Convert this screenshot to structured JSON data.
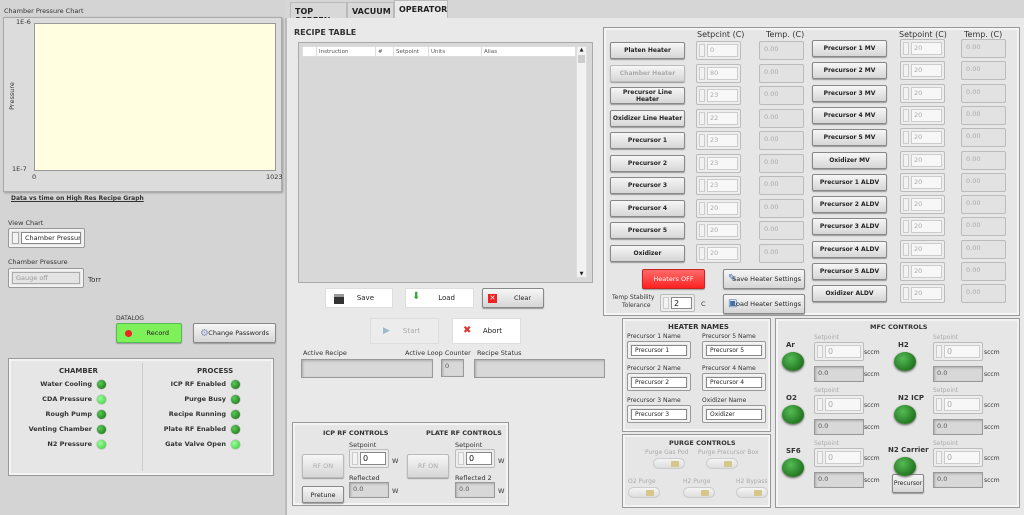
{
  "left": {
    "chart": {
      "title": "Chamber Pressure Chart",
      "ylabel": "Pressure",
      "y_max_label": "1E-6",
      "y_min_label": "1E-7",
      "x_min_label": "0",
      "x_max_label": "1023",
      "background": "#fffee0"
    },
    "chart_link": "Data vs time on High Res Recipe Graph",
    "view_chart": {
      "label": "View Chart",
      "value": "Chamber Pressure"
    },
    "chamber_pressure": {
      "label": "Chamber Pressure",
      "value": "Gauge off",
      "unit": "Torr"
    },
    "datalog": {
      "label": "DATALOG",
      "record": "Record"
    },
    "change_passwords": "Change Passwords",
    "chamber": {
      "title": "CHAMBER",
      "items": [
        {
          "label": "Water Cooling",
          "on": false
        },
        {
          "label": "CDA Pressure",
          "on": true
        },
        {
          "label": "Rough Pump",
          "on": false
        },
        {
          "label": "Venting Chamber",
          "on": false
        },
        {
          "label": "N2 Pressure",
          "on": true
        }
      ]
    },
    "process": {
      "title": "PROCESS",
      "items": [
        {
          "label": "ICP RF Enabled",
          "on": false
        },
        {
          "label": "Purge Busy",
          "on": false
        },
        {
          "label": "Recipe Running",
          "on": false
        },
        {
          "label": "Plate RF Enabled",
          "on": false
        },
        {
          "label": "Gate Valve Open",
          "on": true
        }
      ]
    }
  },
  "tabs": [
    {
      "label": "TOP SCREEN"
    },
    {
      "label": "VACUUM"
    },
    {
      "label": "OPERATOR",
      "active": true
    }
  ],
  "recipe": {
    "title": "RECIPE TABLE",
    "columns": [
      "Instruction",
      "#",
      "Setpoint",
      "Units",
      "Alias"
    ],
    "row_indices": [
      "0",
      "1",
      "2",
      "3",
      "4",
      "5",
      "6",
      "7",
      "8",
      "9",
      "10",
      "11",
      "12",
      "13",
      "14",
      "15",
      "16",
      "17",
      "18",
      "19",
      "20",
      "21"
    ],
    "save": "Save",
    "load": "Load",
    "clear": "Clear",
    "start": "Start",
    "abort": "Abort",
    "active_recipe": {
      "label": "Active Recipe",
      "value": ""
    },
    "loop_counter": {
      "label": "Active Loop Counter",
      "value": "0"
    },
    "recipe_status": {
      "label": "Recipe Status",
      "value": ""
    }
  },
  "rf": {
    "icp": {
      "title": "ICP RF CONTROLS",
      "rf_on": "RF ON",
      "pretune": "Pretune",
      "setpoint_label": "Setpoint",
      "setpoint": "0",
      "reflected_label": "Reflected",
      "reflected": "0.0",
      "unit": "W"
    },
    "plate": {
      "title": "PLATE RF CONTROLS",
      "rf_on": "RF ON",
      "setpoint_label": "Setpoint",
      "setpoint": "0",
      "reflected_label": "Reflected 2",
      "reflected": "0.0",
      "unit": "W"
    }
  },
  "heaters": {
    "setpoint_header": "Setpcint (C)",
    "temp_header": "Temp. (C)",
    "setpoint_header2": "Setpoint (C)",
    "temp_header2": "Temp. (C)",
    "left": [
      {
        "name": "Platen Heater",
        "setpoint": "0",
        "temp": "0.00"
      },
      {
        "name": "Chamber Heater",
        "setpoint": "80",
        "temp": "0.00",
        "disabled": true
      },
      {
        "name": "Precursor Line Heater",
        "setpoint": "23",
        "temp": "0.00"
      },
      {
        "name": "Oxidizer Line Heater",
        "setpoint": "22",
        "temp": "0.00"
      },
      {
        "name": "Precursor 1",
        "setpoint": "23",
        "temp": "0.00"
      },
      {
        "name": "Precursor 2",
        "setpoint": "23",
        "temp": "0.00"
      },
      {
        "name": "Precursor 3",
        "setpoint": "23",
        "temp": "0.00"
      },
      {
        "name": "Precursor 4",
        "setpoint": "20",
        "temp": "0.00"
      },
      {
        "name": "Precursor 5",
        "setpoint": "20",
        "temp": "0.00"
      },
      {
        "name": "Oxidizer",
        "setpoint": "20",
        "temp": "0.00"
      }
    ],
    "right": [
      {
        "name": "Precursor 1 MV",
        "setpoint": "20",
        "temp": "0.00"
      },
      {
        "name": "Precursor 2 MV",
        "setpoint": "20",
        "temp": "0.00"
      },
      {
        "name": "Precursor 3 MV",
        "setpoint": "20",
        "temp": "0.00"
      },
      {
        "name": "Precursor 4 MV",
        "setpoint": "20",
        "temp": "0.00"
      },
      {
        "name": "Precursor 5 MV",
        "setpoint": "20",
        "temp": "0.00"
      },
      {
        "name": "Oxidizer MV",
        "setpoint": "20",
        "temp": "0.00"
      },
      {
        "name": "Precursor 1 ALDV",
        "setpoint": "20",
        "temp": "0.00"
      },
      {
        "name": "Precursor 2 ALDV",
        "setpoint": "20",
        "temp": "0.00"
      },
      {
        "name": "Precursor 3 ALDV",
        "setpoint": "20",
        "temp": "0.00"
      },
      {
        "name": "Precursor 4 ALDV",
        "setpoint": "20",
        "temp": "0.00"
      },
      {
        "name": "Precursor 5 ALDV",
        "setpoint": "20",
        "temp": "0.00"
      },
      {
        "name": "Oxidizer ALDV",
        "setpoint": "20",
        "temp": "0.00"
      }
    ],
    "heaters_off": "Heaters OFF",
    "heaters_off_color": "#ff3b3b",
    "save_settings": "Save Heater Settings",
    "load_settings": "Load Heater Settings",
    "tolerance_label_1": "Temp Stability",
    "tolerance_label_2": "Tolerance",
    "tolerance": "2",
    "tolerance_unit": "C"
  },
  "heater_names": {
    "title": "HEATER NAMES",
    "fields": [
      {
        "label": "Precursor 1 Name",
        "value": "Precursor 1"
      },
      {
        "label": "Precursor 5 Name",
        "value": "Precursor 5"
      },
      {
        "label": "Precursor 2 Name",
        "value": "Precursor 2"
      },
      {
        "label": "Precursor 4 Name",
        "value": "Precursor 4"
      },
      {
        "label": "Precursor 3 Name",
        "value": "Precursor 3"
      },
      {
        "label": "Oxidizer Name",
        "value": "Oxidizer"
      }
    ]
  },
  "purge": {
    "title": "PURGE CONTROLS",
    "items": [
      {
        "label": "Purge Gas Pod"
      },
      {
        "label": "Purge Precursor Box"
      },
      {
        "label": "O2 Purge"
      },
      {
        "label": "H2 Purge"
      },
      {
        "label": "H2 Bypass"
      }
    ]
  },
  "mfc": {
    "title": "MFC CONTROLS",
    "setpoint_label": "Setpoint",
    "unit": "sccm",
    "precursor_button": "Precursor",
    "items": [
      {
        "gas": "Ar",
        "setpoint": "0",
        "actual": "0.0"
      },
      {
        "gas": "H2",
        "setpoint": "0",
        "actual": "0.0"
      },
      {
        "gas": "O2",
        "setpoint": "0",
        "actual": "0.0"
      },
      {
        "gas": "N2 ICP",
        "setpoint": "0",
        "actual": "0.0"
      },
      {
        "gas": "SF6",
        "setpoint": "0",
        "actual": "0.0"
      },
      {
        "gas": "N2 Carrier",
        "setpoint": "0",
        "actual": "0.0"
      }
    ]
  }
}
